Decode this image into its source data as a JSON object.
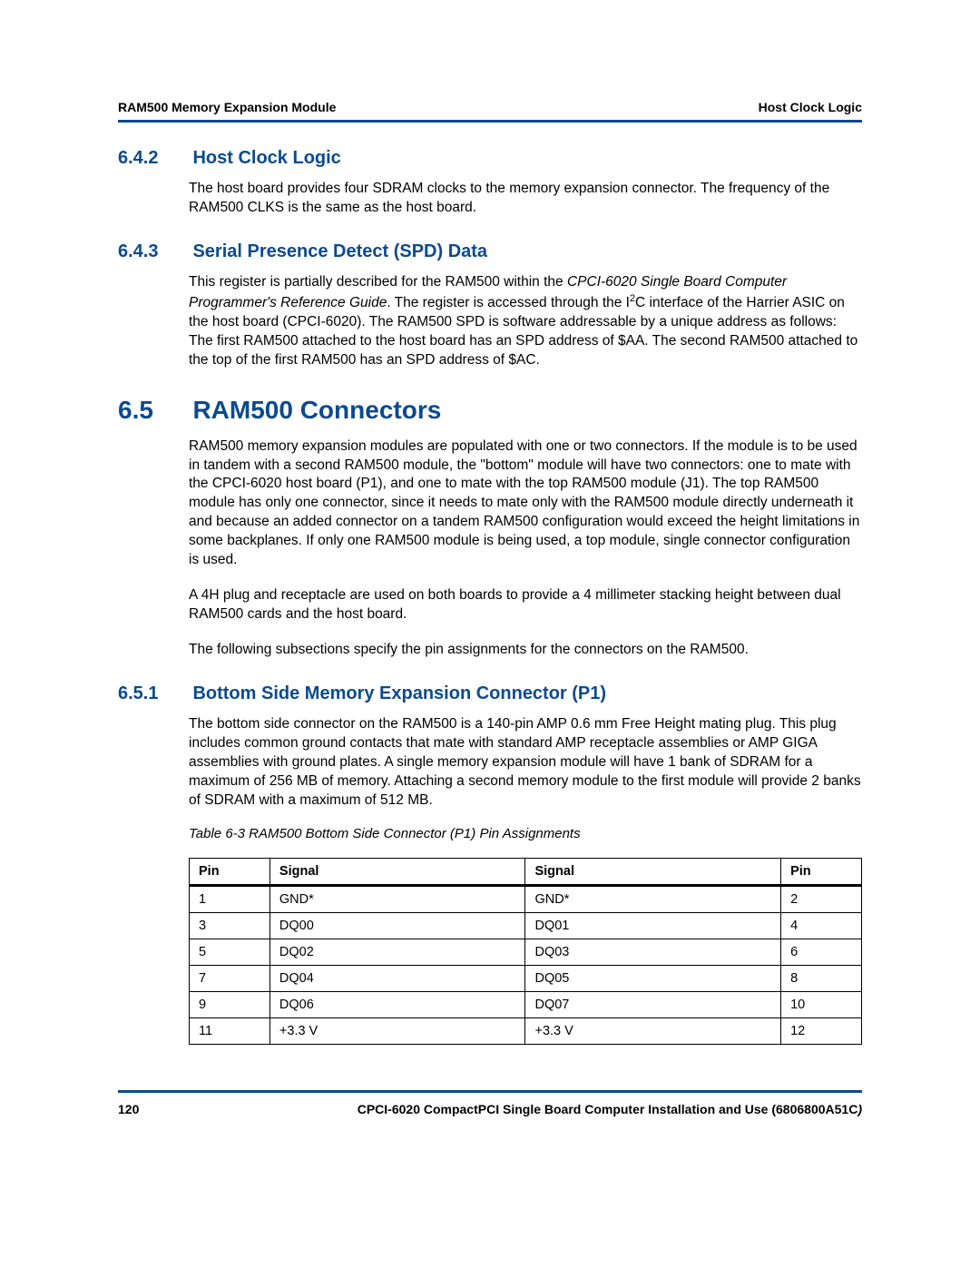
{
  "header": {
    "left": "RAM500 Memory Expansion Module",
    "right": "Host Clock Logic"
  },
  "sections": {
    "s642": {
      "num": "6.4.2",
      "title": "Host Clock Logic",
      "p1": "The host board provides four SDRAM clocks to the memory expansion connector. The frequency of the RAM500 CLKS is the same as the host board."
    },
    "s643": {
      "num": "6.4.3",
      "title": "Serial Presence Detect (SPD) Data",
      "p1a": "This register is partially described for the RAM500 within the ",
      "p1b_italic": "CPCI-6020 Single Board Computer Programmer's Reference Guide",
      "p1c": ". The register is accessed through the I",
      "p1d_sup": "2",
      "p1e": "C interface of the Harrier ASIC on the host board (CPCI-6020). The RAM500 SPD is software addressable by a unique address as follows: The first RAM500 attached to the host board has an SPD address of $AA. The second RAM500 attached to the top of the first RAM500 has an SPD address of $AC."
    },
    "s65": {
      "num": "6.5",
      "title": "RAM500 Connectors",
      "p1": "RAM500 memory expansion modules are populated with one or two connectors. If the module is to be used in tandem with a second RAM500 module, the \"bottom\" module will have two connectors: one to mate with the CPCI-6020 host board (P1), and one to mate with the top RAM500 module (J1). The top RAM500 module has only one connector, since it needs to mate only with the RAM500 module directly underneath it and because an added connector on a tandem RAM500 configuration would exceed the height limitations in some backplanes. If only one RAM500 module is being used, a top module, single connector configuration is used.",
      "p2": "A 4H plug and receptacle are used on both boards to provide a 4 millimeter stacking height between dual RAM500 cards and the host board.",
      "p3": "The following subsections specify the pin assignments for the connectors on the RAM500."
    },
    "s651": {
      "num": "6.5.1",
      "title": "Bottom Side Memory Expansion Connector (P1)",
      "p1": "The bottom side connector on the RAM500 is a 140-pin AMP 0.6 mm Free Height mating plug. This plug includes common ground contacts that mate with standard AMP receptacle assemblies or AMP GIGA assemblies with ground plates. A single memory expansion module will have 1 bank of SDRAM for a maximum of 256 MB of memory. Attaching a second memory module to the first module will provide 2 banks of SDRAM with a maximum of 512 MB."
    }
  },
  "table": {
    "caption": "Table 6-3 RAM500 Bottom Side Connector (P1) Pin Assignments",
    "headers": [
      "Pin",
      "Signal",
      "Signal",
      "Pin"
    ],
    "rows": [
      [
        "1",
        "GND*",
        "GND*",
        "2"
      ],
      [
        "3",
        "DQ00",
        "DQ01",
        "4"
      ],
      [
        "5",
        "DQ02",
        "DQ03",
        "6"
      ],
      [
        "7",
        "DQ04",
        "DQ05",
        "8"
      ],
      [
        "9",
        "DQ06",
        "DQ07",
        "10"
      ],
      [
        "11",
        "+3.3 V",
        "+3.3 V",
        "12"
      ]
    ]
  },
  "footer": {
    "page": "120",
    "doc_a": "CPCI-6020 CompactPCI Single Board Computer Installation and Use (6806800A51C",
    "doc_b_italic": ")"
  }
}
